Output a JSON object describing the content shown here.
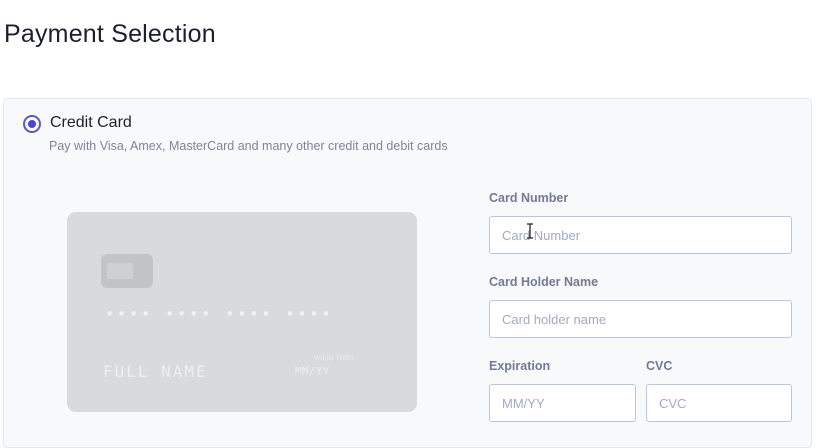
{
  "page": {
    "title": "Payment Selection"
  },
  "payment_method": {
    "label": "Credit Card",
    "description": "Pay with Visa, Amex, MasterCard and many other credit and debit cards",
    "selected": true
  },
  "card_preview": {
    "number": "•••• •••• •••• ••••",
    "name": "FULL NAME",
    "expiry_label": "VALID THRU",
    "expiry": "MM/YY"
  },
  "form": {
    "card_number": {
      "label": "Card Number",
      "placeholder": "Card Number",
      "value": ""
    },
    "holder_name": {
      "label": "Card Holder Name",
      "placeholder": "Card holder name",
      "value": ""
    },
    "expiration": {
      "label": "Expiration",
      "placeholder": "MM/YY",
      "value": ""
    },
    "cvc": {
      "label": "CVC",
      "placeholder": "CVC",
      "value": ""
    }
  },
  "colors": {
    "accent": "#4b44d1",
    "card_background": "#d9dadd",
    "input_border": "#b9c5e4",
    "label": "#717a96"
  },
  "icons": {
    "cursor": "text-cursor-icon"
  }
}
